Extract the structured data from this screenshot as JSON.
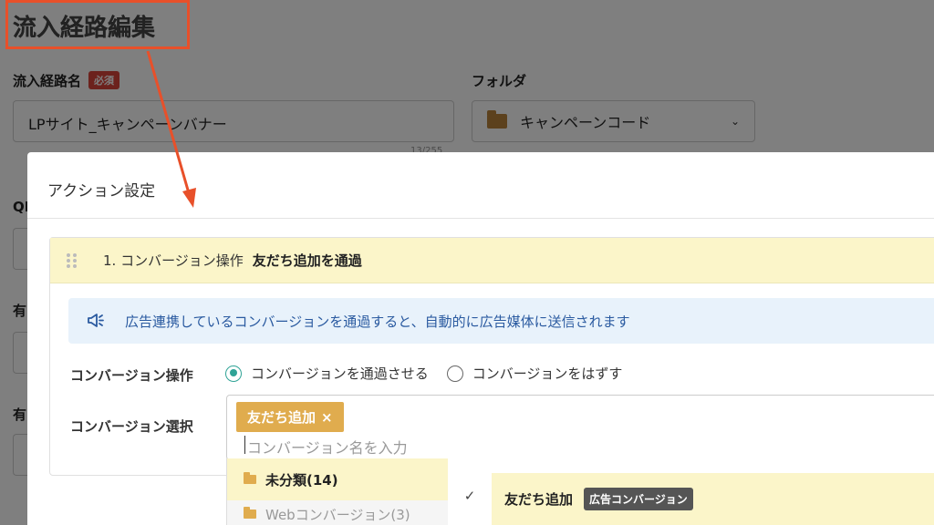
{
  "page": {
    "title": "流入経路編集",
    "name_label": "流入経路名",
    "required_badge": "必須",
    "name_value": "LPサイト_キャンペーンバナー",
    "name_counter": "13/255",
    "folder_label": "フォルダ",
    "folder_value": "キャンペーンコード",
    "side_label_1": "QR",
    "side_label_2": "有",
    "side_label_3": "有"
  },
  "modal": {
    "title": "アクション設定",
    "action": {
      "number_label": "1. コンバージョン操作",
      "summary": "友だち追加を通過",
      "info_text": "広告連携しているコンバージョンを通過すると、自動的に広告媒体に送信されます",
      "operation_label": "コンバージョン操作",
      "radio_options": [
        "コンバージョンを通過させる",
        "コンバージョンをはずす"
      ],
      "selected_radio": 0,
      "selection_label": "コンバージョン選択",
      "selected_chip": "友だち追加",
      "chip_remove": "×",
      "search_placeholder": "コンバージョン名を入力"
    }
  },
  "dropdown": {
    "categories": [
      {
        "label": "未分類(14)",
        "active": true
      },
      {
        "label": "Webコンバージョン(3)",
        "active": false
      }
    ],
    "items": [
      {
        "check": "✓",
        "label": "友だち追加",
        "badge": "広告コンバージョン"
      }
    ]
  },
  "colors": {
    "annotation": "#e8502a",
    "accent_teal": "#2fa396",
    "chip": "#e0ac4e",
    "highlight": "#fbf5c9",
    "info_bg": "#e8f2fb",
    "info_text": "#2a5aa0"
  }
}
